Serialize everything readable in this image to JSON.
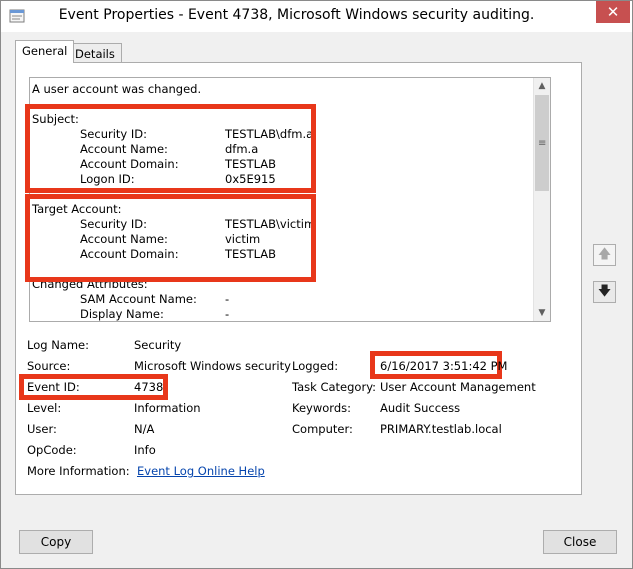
{
  "window": {
    "title": "Event Properties - Event 4738, Microsoft Windows security auditing.",
    "close_glyph": "✕"
  },
  "tabs": [
    {
      "label": "General",
      "active": true
    },
    {
      "label": "Details",
      "active": false
    }
  ],
  "description": {
    "summary": "A user account was changed.",
    "subject_heading": "Subject:",
    "subject": [
      {
        "label": "Security ID:",
        "value": "TESTLAB\\dfm.a"
      },
      {
        "label": "Account Name:",
        "value": "dfm.a"
      },
      {
        "label": "Account Domain:",
        "value": "TESTLAB"
      },
      {
        "label": "Logon ID:",
        "value": "0x5E915"
      }
    ],
    "target_heading": "Target Account:",
    "target": [
      {
        "label": "Security ID:",
        "value": "TESTLAB\\victim"
      },
      {
        "label": "Account Name:",
        "value": "victim"
      },
      {
        "label": "Account Domain:",
        "value": "TESTLAB"
      }
    ],
    "changed_heading": "Changed Attributes:",
    "changed": [
      {
        "label": "SAM Account Name:",
        "value": "-"
      },
      {
        "label": "Display Name:",
        "value": "-"
      }
    ]
  },
  "fields": {
    "log_name_label": "Log Name:",
    "log_name": "Security",
    "source_label": "Source:",
    "source": "Microsoft Windows security",
    "logged_label": "Logged:",
    "logged": "6/16/2017 3:51:42 PM",
    "event_id_label": "Event ID:",
    "event_id": "4738",
    "task_category_label": "Task Category:",
    "task_category": "User Account Management",
    "level_label": "Level:",
    "level": "Information",
    "keywords_label": "Keywords:",
    "keywords": "Audit Success",
    "user_label": "User:",
    "user": "N/A",
    "computer_label": "Computer:",
    "computer": "PRIMARY.testlab.local",
    "opcode_label": "OpCode:",
    "opcode": "Info",
    "more_info_label": "More Information:",
    "more_info_link": "Event Log Online Help"
  },
  "buttons": {
    "copy": "Copy",
    "close": "Close"
  },
  "accent": {
    "highlight_red": "#e8371a",
    "link_blue": "#0645ad"
  }
}
